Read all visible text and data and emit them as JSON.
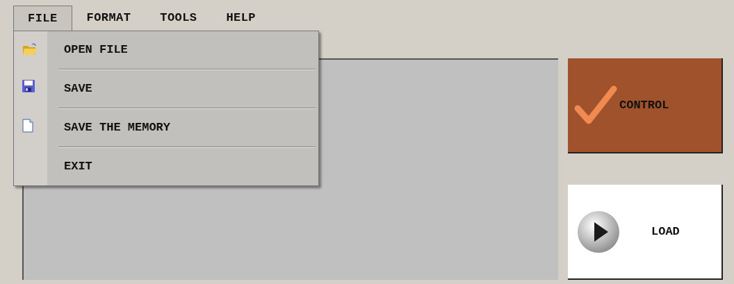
{
  "menu_bar": [
    {
      "label": "FILE",
      "selected": true
    },
    {
      "label": "FORMAT",
      "selected": false
    },
    {
      "label": "TOOLS",
      "selected": false
    },
    {
      "label": "HELP",
      "selected": false
    }
  ],
  "file_menu": {
    "items": [
      {
        "label": "OPEN FILE"
      },
      {
        "label": "SAVE"
      },
      {
        "label": "SAVE THE MEMORY"
      },
      {
        "label": "EXIT"
      }
    ]
  },
  "buttons": [
    {
      "label": "CONTROL",
      "kind": "check"
    },
    {
      "label": "LOAD",
      "kind": "play"
    }
  ]
}
